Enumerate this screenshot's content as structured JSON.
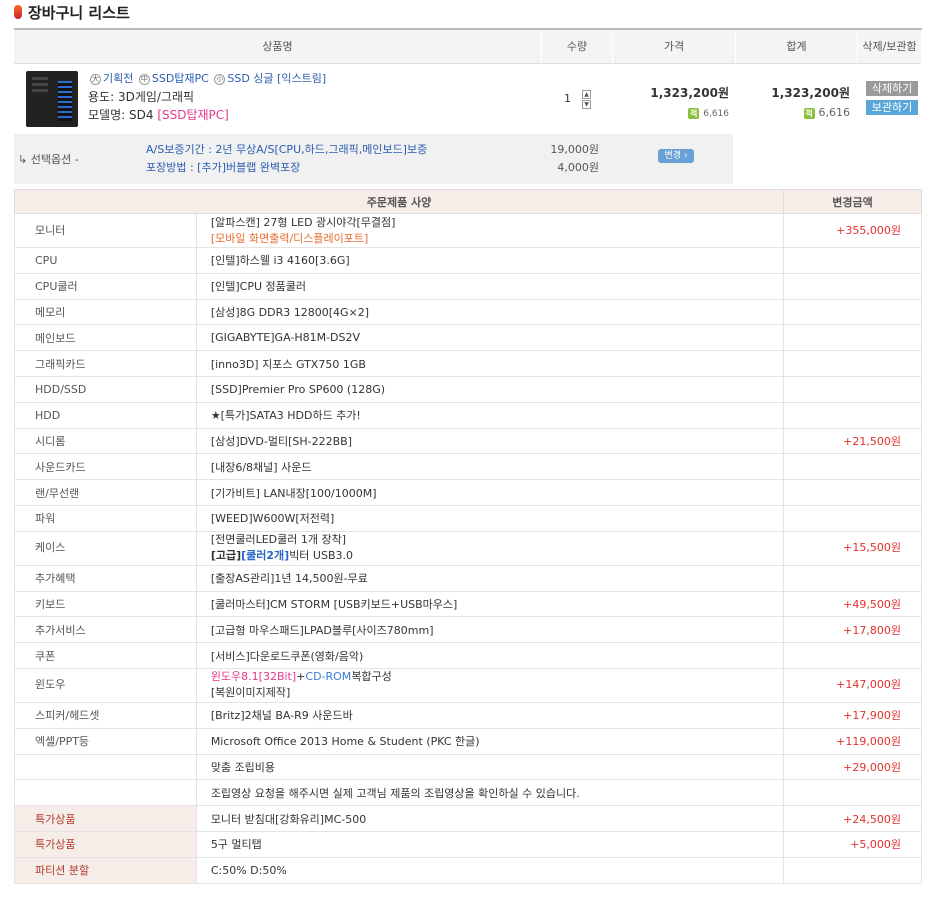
{
  "page_title": "장바구니 리스트",
  "header": {
    "product": "상품명",
    "qty": "수량",
    "price": "가격",
    "total": "합계",
    "action": "삭제/보관함"
  },
  "product": {
    "tags": [
      "기획전",
      "SSD탑재PC",
      "SSD 싱글 [익스트림]"
    ],
    "tag_icons": [
      "大",
      "中",
      "小"
    ],
    "usage_label": "용도: 3D게임/그래픽",
    "model_prefix": "모델명: SD4",
    "model_highlight": "[SSD탑재PC]",
    "qty": "1",
    "price": "1,323,200원",
    "price_points": "6,616",
    "total": "1,323,200원",
    "total_points": "6,616",
    "point_icon": "적",
    "delete_btn": "삭제하기",
    "save_btn": "보관하기"
  },
  "option": {
    "label": "↳ 선택옵션 -",
    "items": [
      {
        "text": "A/S보증기간 : 2년 무상A/S[CPU,하드,그래픽,메인보드]보증",
        "price": "19,000원"
      },
      {
        "text": "포장방법 : [추가]버블랩 완벽포장",
        "price": "4,000원"
      }
    ],
    "change_btn": "변경 ›"
  },
  "spec": {
    "head_spec": "주문제품 사양",
    "head_price": "변경금액",
    "rows": [
      {
        "k": "모니터",
        "v": "[알파스캔] 27형 LED 광시야각[무결점]",
        "v2": "[모바일 화면출력/디스플레이포트]",
        "p": "+355,000원"
      },
      {
        "k": "CPU",
        "v": "[인텔]하스웰 i3 4160[3.6G]",
        "p": ""
      },
      {
        "k": "CPU쿨러",
        "v": "[인텔]CPU 정품쿨러",
        "p": ""
      },
      {
        "k": "메모리",
        "v": "[삼성]8G DDR3 12800[4G×2]",
        "p": ""
      },
      {
        "k": "메인보드",
        "v": "[GIGABYTE]GA-H81M-DS2V",
        "p": ""
      },
      {
        "k": "그래픽카드",
        "v": "[inno3D] 지포스 GTX750 1GB",
        "p": ""
      },
      {
        "k": "HDD/SSD",
        "v": "[SSD]Premier Pro SP600 (128G)",
        "p": ""
      },
      {
        "k": "HDD",
        "v": "★[특가]SATA3 HDD하드 추가!",
        "p": ""
      },
      {
        "k": "시디롬",
        "v": "[삼성]DVD-멀티[SH-222BB]",
        "p": "+21,500원"
      },
      {
        "k": "사운드카드",
        "v": "[내장6/8채널] 사운드",
        "p": ""
      },
      {
        "k": "랜/무선랜",
        "v": "[기가비트] LAN내장[100/1000M]",
        "p": ""
      },
      {
        "k": "파워",
        "v": "[WEED]W600W[저전력]",
        "p": ""
      },
      {
        "k": "케이스",
        "v": "[전면쿨러LED쿨러 1개 장착]",
        "v2a": "[고급]",
        "v2b": "[쿨러2개]",
        "v2c": "빅터 USB3.0",
        "p": "+15,500원"
      },
      {
        "k": "추가혜택",
        "v": "[출장AS관리]1년 14,500원-무료",
        "p": ""
      },
      {
        "k": "키보드",
        "v": "[쿨러마스터]CM STORM [USB키보드+USB마우스]",
        "p": "+49,500원"
      },
      {
        "k": "추가서비스",
        "v": "[고급형 마우스패드]LPAD블루[사이즈780mm]",
        "p": "+17,800원"
      },
      {
        "k": "쿠폰",
        "v": "[서비스]다운로드쿠폰(영화/음악)",
        "p": ""
      },
      {
        "k": "윈도우",
        "va": "윈도우8.1[32Bit]",
        "vb": "+",
        "vc": "CD-ROM",
        "vd": "복합구성",
        "v2": "[복원이미지제작]",
        "p": "+147,000원"
      },
      {
        "k": "스피커/헤드셋",
        "v": "[Britz]2채널 BA-R9 사운드바",
        "p": "+17,900원"
      },
      {
        "k": "엑셀/PPT등",
        "v": "Microsoft Office 2013 Home & Student (PKC 한글)",
        "p": "+119,000원"
      },
      {
        "k": "",
        "v": "맞춤 조립비용",
        "p": "+29,000원"
      },
      {
        "k": "",
        "v": "조립영상 요청을 해주시면 실제 고객님 제품의 조립영상을 확인하실 수 있습니다.",
        "p": ""
      },
      {
        "k": "특가상품",
        "v": "모니터 받침대[강화유리]MC-500",
        "p": "+24,500원"
      },
      {
        "k": "특가상품",
        "v": "5구 멀티탭",
        "p": "+5,000원"
      },
      {
        "k": "파티션 분할",
        "v": "C:50% D:50%",
        "p": ""
      }
    ]
  },
  "colors": {
    "accent_red": "#e2322d",
    "link_blue": "#2a5db0",
    "pink": "#e23b8c",
    "header_bg": "#f6ede8"
  }
}
